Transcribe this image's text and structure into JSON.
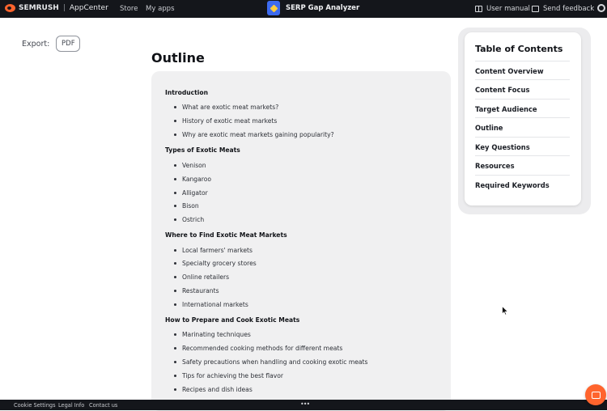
{
  "topbar": {
    "brand": "SEMRUSH",
    "brand_section": "AppCenter",
    "nav": [
      "Store",
      "My apps"
    ],
    "app_name": "SERP Gap Analyzer",
    "user_manual": "User manual",
    "send_feedback": "Send feedback"
  },
  "export": {
    "label": "Export:",
    "pdf": "PDF"
  },
  "outline": {
    "title": "Outline",
    "sections": [
      {
        "title": "Introduction",
        "items": [
          "What are exotic meat markets?",
          "History of exotic meat markets",
          "Why are exotic meat markets gaining popularity?"
        ]
      },
      {
        "title": "Types of Exotic Meats",
        "items": [
          "Venison",
          "Kangaroo",
          "Alligator",
          "Bison",
          "Ostrich"
        ]
      },
      {
        "title": "Where to Find Exotic Meat Markets",
        "items": [
          "Local farmers' markets",
          "Specialty grocery stores",
          "Online retailers",
          "Restaurants",
          "International markets"
        ]
      },
      {
        "title": "How to Prepare and Cook Exotic Meats",
        "items": [
          "Marinating techniques",
          "Recommended cooking methods for different meats",
          "Safety precautions when handling and cooking exotic meats",
          "Tips for achieving the best flavor",
          "Recipes and dish ideas"
        ]
      }
    ]
  },
  "toc": {
    "title": "Table of Contents",
    "items": [
      "Content Overview",
      "Content Focus",
      "Target Audience",
      "Outline",
      "Key Questions",
      "Resources",
      "Required Keywords"
    ]
  },
  "footer": {
    "links": [
      "Cookie Settings",
      "Legal Info",
      "Contact us"
    ],
    "more": "•••"
  },
  "colors": {
    "accent": "#ff642d",
    "topbar_bg": "#14161b",
    "outline_bg": "#f0f0f1"
  },
  "icons": {
    "logo": "semrush-logo-icon",
    "app": "serp-gap-analyzer-icon",
    "manual": "book-icon",
    "feedback": "chat-icon",
    "settings": "gear-icon",
    "chat_fab": "chat-bubble-icon"
  }
}
